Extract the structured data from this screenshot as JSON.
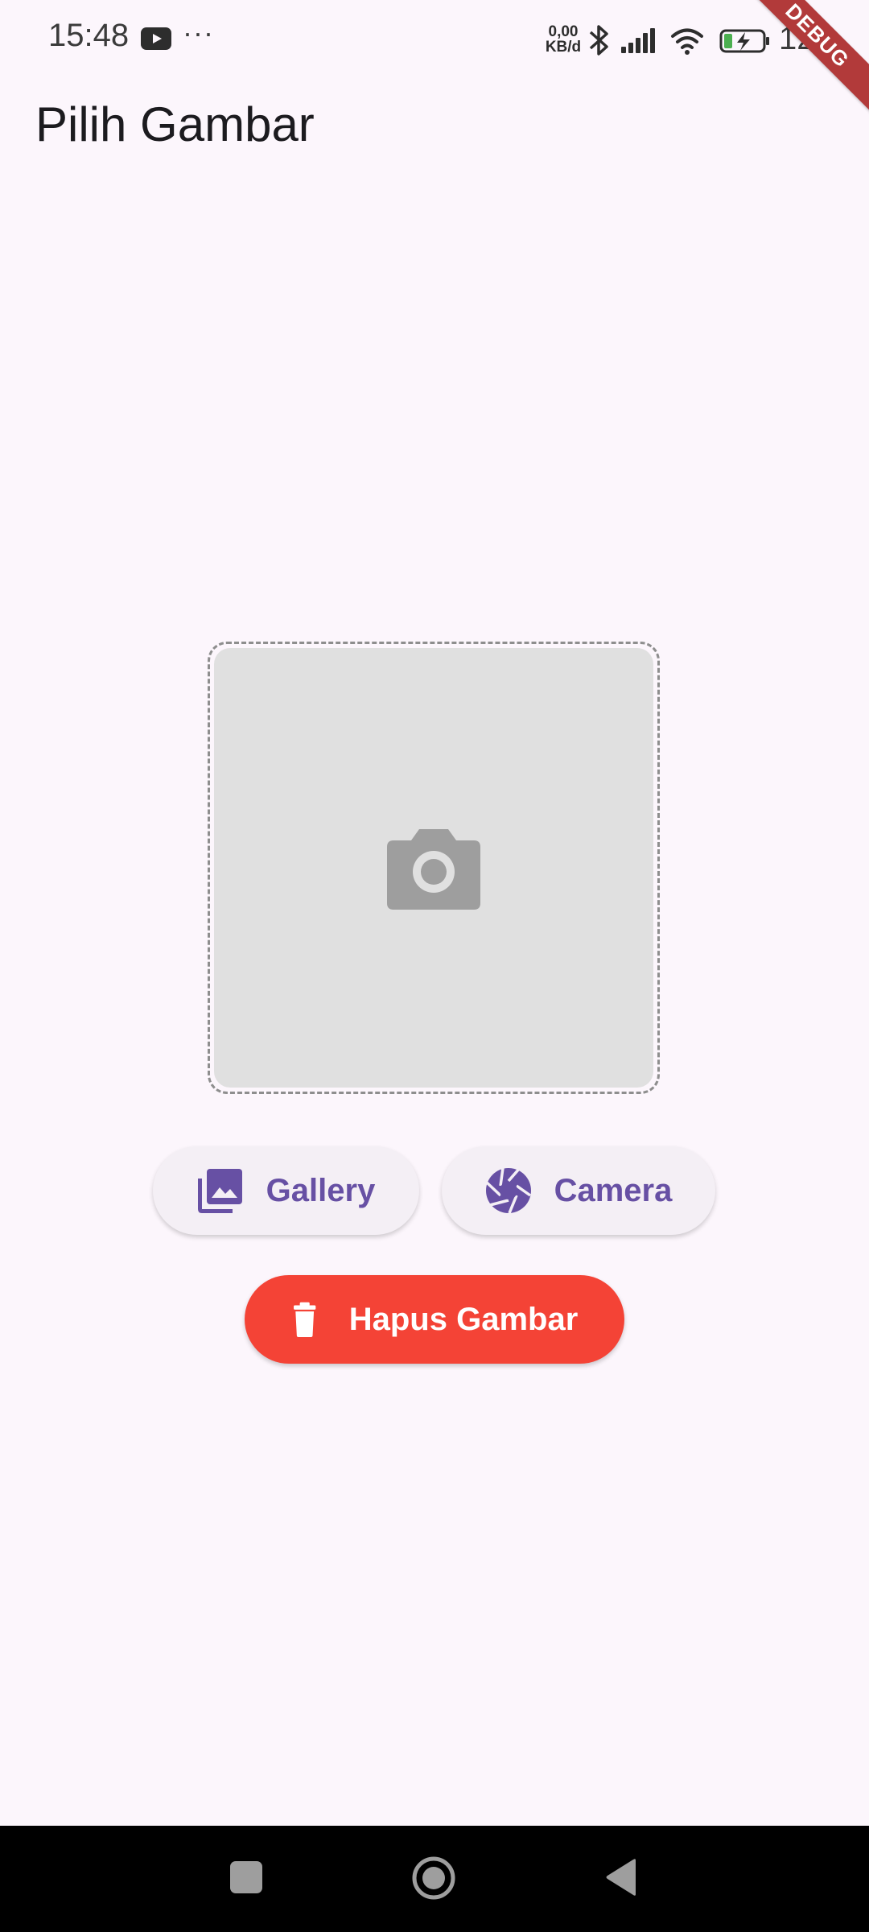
{
  "status_bar": {
    "time": "15:48",
    "more": "···",
    "net_speed_value": "0,00",
    "net_speed_unit": "KB/d",
    "battery_text": "12"
  },
  "debug_banner": "DEBUG",
  "app_bar": {
    "title": "Pilih Gambar"
  },
  "image_placeholder": {
    "icon": "camera-icon"
  },
  "buttons": {
    "gallery": {
      "label": "Gallery",
      "icon": "photo-library-icon"
    },
    "camera": {
      "label": "Camera",
      "icon": "camera-shutter-icon"
    },
    "delete": {
      "label": "Hapus Gambar",
      "icon": "trash-icon"
    }
  },
  "navigation": {
    "recents": "recents-icon",
    "home": "home-icon",
    "back": "back-icon"
  },
  "colors": {
    "background": "#fcf6fc",
    "primary": "#6750a4",
    "danger": "#f44336",
    "placeholder": "#e0e0e0"
  }
}
